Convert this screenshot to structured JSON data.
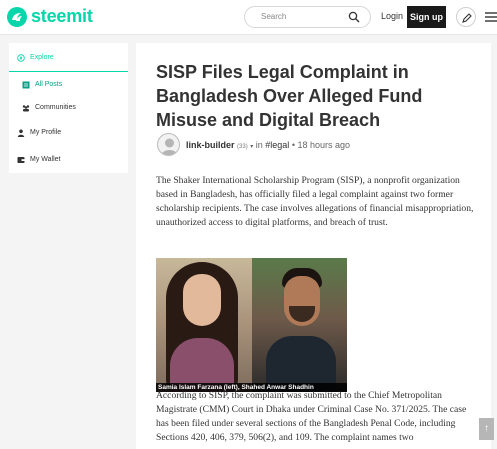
{
  "header": {
    "logo_text": "steemit",
    "search_placeholder": "Search",
    "login_label": "Login",
    "signup_label": "Sign up"
  },
  "sidebar": {
    "items": [
      {
        "label": "Explore",
        "icon": "compass-icon"
      },
      {
        "label": "All Posts",
        "icon": "posts-icon"
      },
      {
        "label": "Communities",
        "icon": "communities-icon"
      },
      {
        "label": "My Profile",
        "icon": "user-icon"
      },
      {
        "label": "My Wallet",
        "icon": "wallet-icon"
      }
    ]
  },
  "post": {
    "title": "SISP Files Legal Complaint in Bangladesh Over Alleged Fund Misuse and Digital Breach",
    "author": "link-builder",
    "reputation": "(33)",
    "in_label": "in",
    "category": "#legal",
    "separator": "•",
    "time": "18 hours ago",
    "paragraph1": "The Shaker International Scholarship Program (SISP), a nonprofit organization based in Bangladesh, has officially filed a legal complaint against two former scholarship recipients. The case involves allegations of financial misappropriation, unauthorized access to digital platforms, and breach of trust.",
    "image_caption": "Samia Islam Farzana (left), Shahed Anwar Shadhin",
    "paragraph2": "According to SISP, the complaint was submitted to the Chief Metropolitan Magistrate (CMM) Court in Dhaka under Criminal Case No. 371/2025. The case has been filed under several sections of the Bangladesh Penal Code, including Sections 420, 406, 379, 506(2), and 109. The complaint names two"
  },
  "scroll_top_label": "↑",
  "colors": {
    "brand": "#06d6a9",
    "signup_bg": "#1a1a1a"
  }
}
